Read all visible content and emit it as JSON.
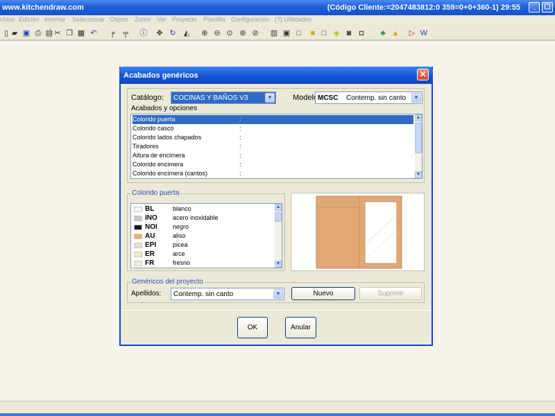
{
  "window": {
    "title": "www.kitchendraw.com",
    "client_code": "(Código Cliente:=2047483812:0 359=0+0+360-1) 29:55",
    "minimize": "_",
    "restore": "▢",
    "close": "✕"
  },
  "menu": [
    "chivo",
    "Edición",
    "Insertar",
    "Seleccionar",
    "Objeto",
    "Zoom",
    "Ver",
    "Proyecto",
    "Plantilla",
    "Configuración",
    "(?) Utilidades"
  ],
  "dialog": {
    "title": "Acabados genéricos",
    "close": "✕",
    "catalog_label": "Catálogo:",
    "catalog_value": "COCINAS Y BAÑOS V3",
    "model_label": "Modelo:",
    "model_code": "MCSC",
    "model_value": "Contemp. sin canto",
    "options_label": "Acabados y opciones",
    "options": [
      {
        "name": "Colorido puerta",
        "sep": ":"
      },
      {
        "name": "Colorido casco",
        "sep": ":"
      },
      {
        "name": "Colorido lados chapados",
        "sep": ":"
      },
      {
        "name": "Tiradores",
        "sep": ":"
      },
      {
        "name": "Altura de encimera",
        "sep": ":"
      },
      {
        "name": "Colorido encimera",
        "sep": ":"
      },
      {
        "name": "Colorido encimera (cantos)",
        "sep": ":"
      }
    ],
    "color_group_label": "Colorido puerta",
    "colors": [
      {
        "code": "BL",
        "name": "blanco",
        "swatch": "#f4f4f4"
      },
      {
        "code": "INO",
        "name": "acero inoxidable",
        "swatch": "#c9c9c9"
      },
      {
        "code": "NOI",
        "name": "negro",
        "swatch": "#1a1a1a"
      },
      {
        "code": "AU",
        "name": "aliso",
        "swatch": "#e2b45f"
      },
      {
        "code": "EPI",
        "name": "picea",
        "swatch": "#e9dfcb"
      },
      {
        "code": "ER",
        "name": "arce",
        "swatch": "#f6ecc6"
      },
      {
        "code": "FR",
        "name": "fresno",
        "swatch": "#f5eecd"
      }
    ],
    "project_group_label": "Genéricos del proyecto",
    "surname_label": "Apellidos:",
    "surname_value": "Contemp. sin canto",
    "new_button": "Nuevo",
    "delete_button": "Suprimir",
    "ok_button": "OK",
    "cancel_button": "Anular"
  },
  "colors": {
    "selection": "#316ac5",
    "group_label": "#2c4fb4",
    "door_wood": "#e1a875",
    "titlebar": "#1f5fd8"
  }
}
